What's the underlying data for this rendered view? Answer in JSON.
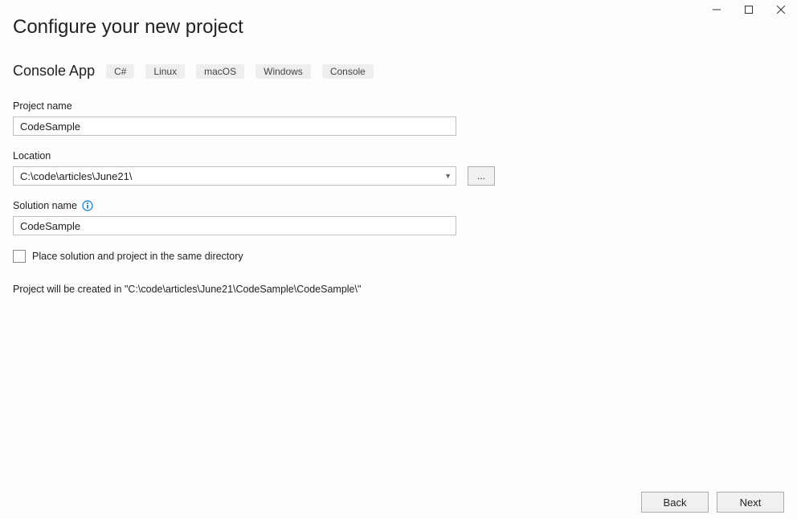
{
  "window": {
    "title": "Configure your new project"
  },
  "template": {
    "name": "Console App",
    "tags": [
      "C#",
      "Linux",
      "macOS",
      "Windows",
      "Console"
    ]
  },
  "fields": {
    "project_name": {
      "label": "Project name",
      "value": "CodeSample"
    },
    "location": {
      "label": "Location",
      "value": "C:\\code\\articles\\June21\\",
      "browse_label": "..."
    },
    "solution_name": {
      "label": "Solution name",
      "value": "CodeSample"
    },
    "same_directory": {
      "label": "Place solution and project in the same directory",
      "checked": false
    }
  },
  "summary": "Project will be created in \"C:\\code\\articles\\June21\\CodeSample\\CodeSample\\\"",
  "footer": {
    "back": "Back",
    "next": "Next"
  }
}
